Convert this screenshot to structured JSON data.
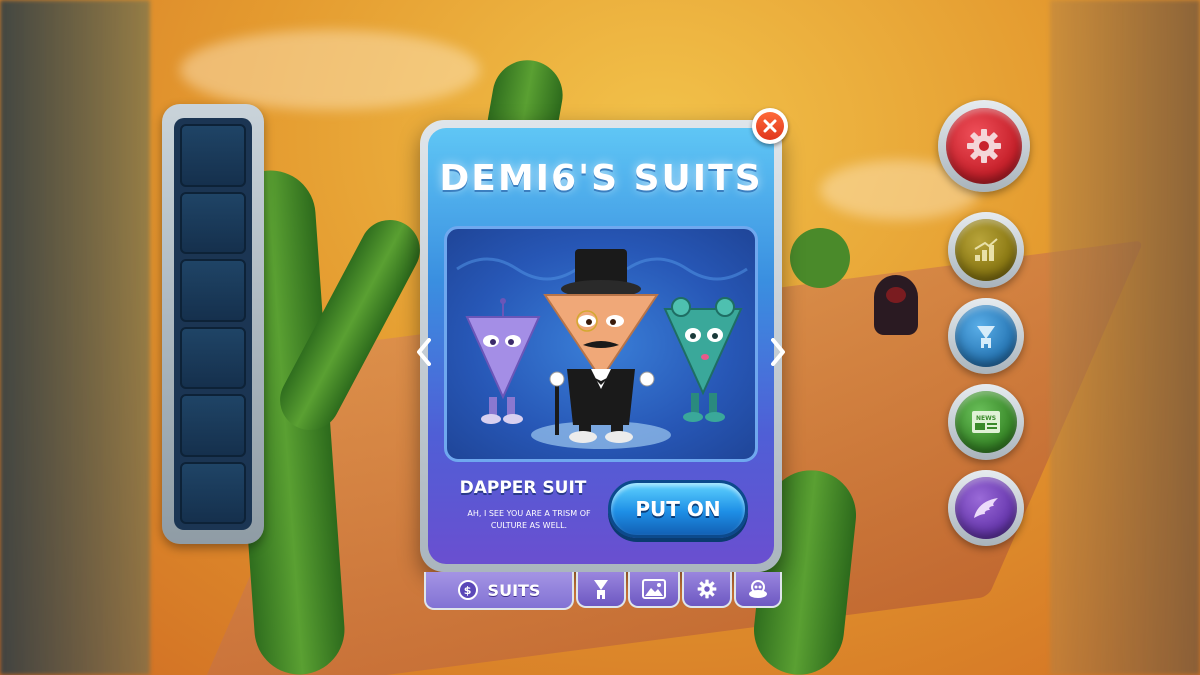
{
  "modal": {
    "title": "DEMI6'S SUITS",
    "suit_name": "DAPPER SUIT",
    "suit_description": "AH, I SEE YOU ARE A TRISM OF CULTURE AS WELL.",
    "put_on_label": "PUT ON"
  },
  "tabs": {
    "items": [
      {
        "label": "SUITS",
        "icon": "coin-icon",
        "active": true
      },
      {
        "label": "",
        "icon": "character-icon",
        "active": false
      },
      {
        "label": "",
        "icon": "image-icon",
        "active": false
      },
      {
        "label": "",
        "icon": "gear-icon",
        "active": false
      },
      {
        "label": "",
        "icon": "alien-icon",
        "active": false
      }
    ],
    "coin_symbol": "$"
  },
  "side_buttons": [
    {
      "icon": "gear-icon",
      "color": "#c8222c"
    },
    {
      "icon": "stats-icon",
      "color": "#8c7a14"
    },
    {
      "icon": "character-icon",
      "color": "#2a7ab8"
    },
    {
      "icon": "news-icon",
      "color": "#3a8a2a"
    },
    {
      "icon": "wing-icon",
      "color": "#6a3ab0"
    }
  ],
  "news_label": "NEWS",
  "inventory_slots": 6,
  "colors": {
    "modal_top": "#5fc6f5",
    "modal_bottom": "#6a4fd0",
    "put_on": "#1e8fe6",
    "close": "#e0361c"
  }
}
